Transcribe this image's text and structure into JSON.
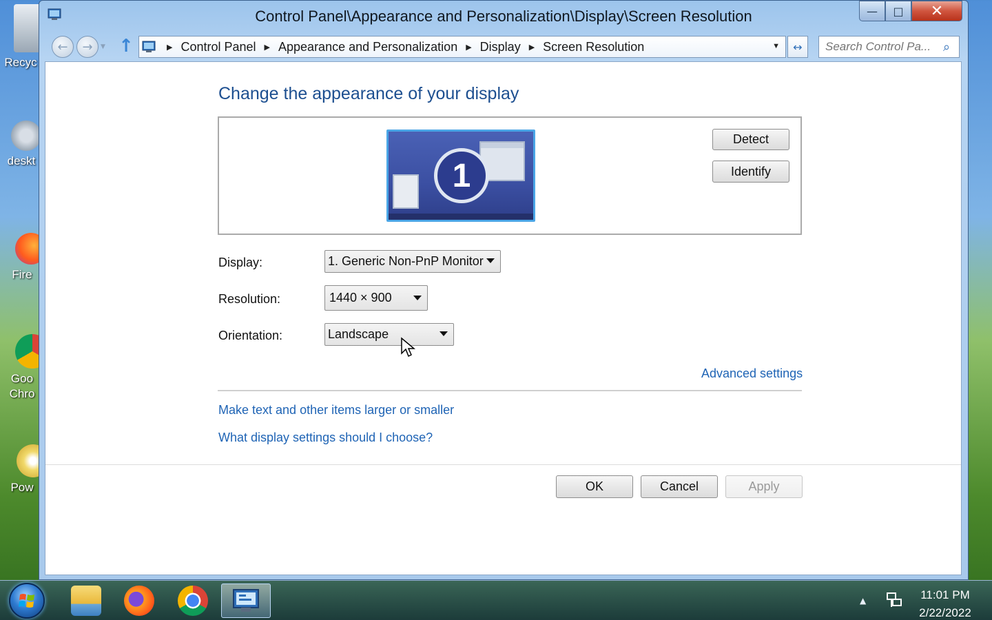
{
  "desktop": {
    "icons": [
      {
        "label": "Recyc",
        "name": "recycle-bin"
      },
      {
        "label": "deskt",
        "name": "desktop-gadgets"
      },
      {
        "label": "Fire",
        "name": "firefox-shortcut"
      },
      {
        "label": "Goo",
        "label2": "Chro",
        "name": "google-chrome-shortcut"
      },
      {
        "label": "Pow",
        "name": "power-shortcut"
      }
    ]
  },
  "window": {
    "title": "Control Panel\\Appearance and Personalization\\Display\\Screen Resolution",
    "minimize_glyph": "—",
    "maximize_glyph": "□",
    "close_glyph": "✕"
  },
  "navbar": {
    "back_glyph": "←",
    "forward_glyph": "→",
    "up_glyph": "↑",
    "refresh_glyph": "↔",
    "breadcrumbs": [
      "Control Panel",
      "Appearance and Personalization",
      "Display",
      "Screen Resolution"
    ],
    "search_placeholder": "Search Control Pa...",
    "search_icon_glyph": "⌕"
  },
  "content": {
    "heading": "Change the appearance of your display",
    "monitor_number": "1",
    "detect_label": "Detect",
    "identify_label": "Identify",
    "display_label": "Display:",
    "display_value": "1. Generic Non-PnP Monitor",
    "resolution_label": "Resolution:",
    "resolution_value": "1440 × 900",
    "orientation_label": "Orientation:",
    "orientation_value": "Landscape",
    "advanced_settings": "Advanced settings",
    "link_text_size": "Make text and other items larger or smaller",
    "link_help": "What display settings should I choose?",
    "ok_label": "OK",
    "cancel_label": "Cancel",
    "apply_label": "Apply"
  },
  "taskbar": {
    "time": "11:01 PM",
    "date": "2/22/2022",
    "tray_arrow_glyph": "▲"
  },
  "colors": {
    "link": "#1f64b5",
    "heading": "#1d4f90",
    "monitor_border": "#4aa5e6",
    "close_button": "#d0553f"
  }
}
